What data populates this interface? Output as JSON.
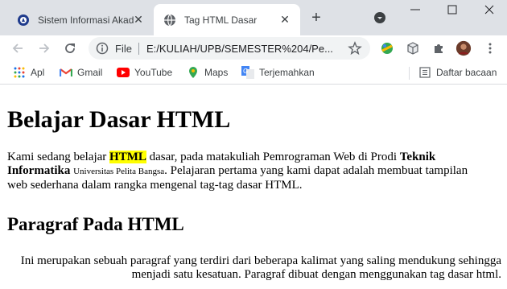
{
  "browser": {
    "tabs": [
      {
        "title": "Sistem Informasi Akad",
        "active": false
      },
      {
        "title": "Tag HTML Dasar",
        "active": true
      }
    ],
    "close_glyph": "✕",
    "new_tab_glyph": "+",
    "address": {
      "scheme_label": "File",
      "url": "E:/KULIAH/UPB/SEMESTER%204/Pe..."
    },
    "bookmarks": [
      {
        "label": "Apl",
        "icon": "apps-grid-icon"
      },
      {
        "label": "Gmail",
        "icon": "gmail-icon"
      },
      {
        "label": "YouTube",
        "icon": "youtube-icon"
      },
      {
        "label": "Maps",
        "icon": "maps-icon"
      },
      {
        "label": "Terjemahkan",
        "icon": "translate-icon"
      }
    ],
    "reading_list": {
      "label": "Daftar bacaan",
      "icon": "reading-list-icon"
    },
    "colors": {
      "tabbar": "#dee1e6",
      "accent": "#1a73e8",
      "youtube": "#ff0000"
    }
  },
  "page": {
    "heading": "Belajar Dasar HTML",
    "para1": {
      "t1": "Kami sedang belajar ",
      "highlight": "HTML",
      "t2": " dasar, pada matakuliah Pemrograman Web di Prodi ",
      "bold": "Teknik Informatika",
      "t3": " ",
      "small": "Universitas Pelita Bangsa",
      "t4": ". Pelajaran pertama yang kami dapat adalah membuat tampilan web sederhana dalam rangka mengenal tag-tag dasar HTML."
    },
    "subheading": "Paragraf Pada HTML",
    "para2": "Ini merupakan sebuah paragraf yang terdiri dari beberapa kalimat yang saling mendukung sehingga menjadi satu kesatuan. Paragraf dibuat dengan menggunakan tag dasar html."
  }
}
